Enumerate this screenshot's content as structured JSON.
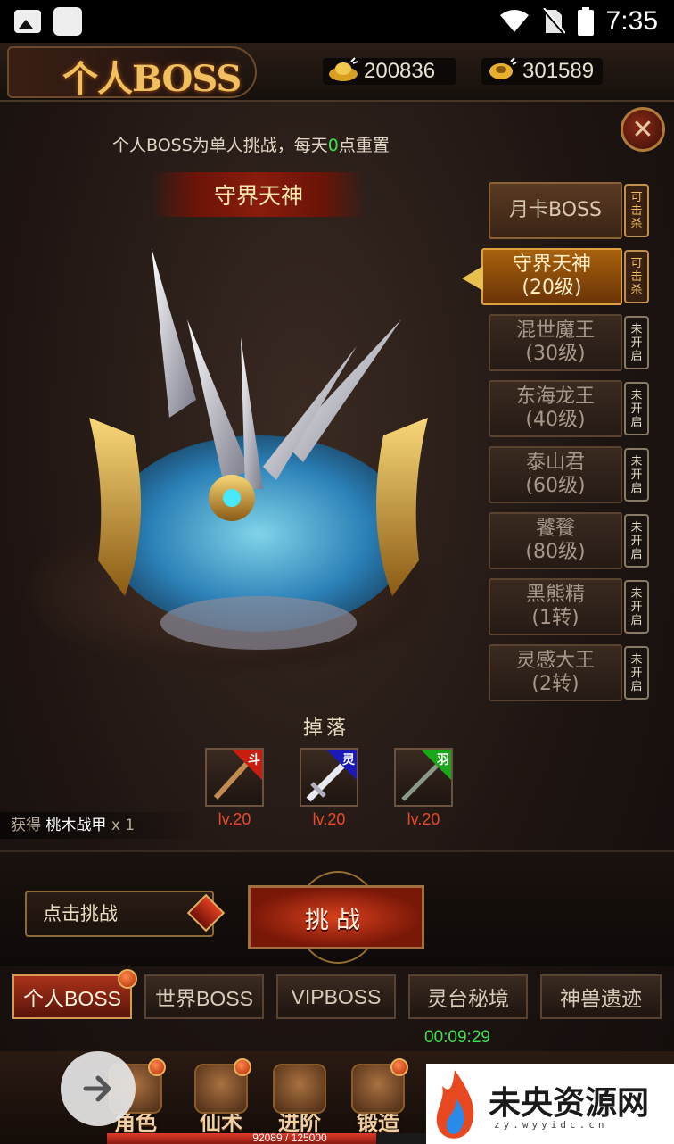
{
  "status_bar": {
    "time": "7:35"
  },
  "header": {
    "title": "个人BOSS",
    "gold": "200836",
    "ingot": "301589"
  },
  "subtitle": {
    "before": "个人BOSS为单人挑战，每天",
    "highlight": "0",
    "after": "点重置"
  },
  "boss_name": "守界天神",
  "boss_list": [
    {
      "name": "月卡BOSS",
      "level": "",
      "tag": "可击杀",
      "state": "top"
    },
    {
      "name": "守界天神",
      "level": "(20级)",
      "tag": "可击杀",
      "state": "active"
    },
    {
      "name": "混世魔王",
      "level": "(30级)",
      "tag": "未开启",
      "state": "locked"
    },
    {
      "name": "东海龙王",
      "level": "(40级)",
      "tag": "未开启",
      "state": "locked"
    },
    {
      "name": "泰山君",
      "level": "(60级)",
      "tag": "未开启",
      "state": "locked"
    },
    {
      "name": "饕餮",
      "level": "(80级)",
      "tag": "未开启",
      "state": "locked"
    },
    {
      "name": "黑熊精",
      "level": "(1转)",
      "tag": "未开启",
      "state": "locked"
    },
    {
      "name": "灵感大王",
      "level": "(2转)",
      "tag": "未开启",
      "state": "locked"
    }
  ],
  "drops": {
    "title": "掉落",
    "items": [
      {
        "badge": "斗",
        "badge_color": "#c81e10",
        "level": "lv.20"
      },
      {
        "badge": "灵",
        "badge_color": "#1a1ab8",
        "level": "lv.20"
      },
      {
        "badge": "羽",
        "badge_color": "#1aa81a",
        "level": "lv.20"
      }
    ]
  },
  "gain": {
    "label": "获得",
    "item": "桃木战甲",
    "count": "x 1"
  },
  "actions": {
    "tap_label": "点击挑战",
    "challenge_label": "挑战"
  },
  "tabs": [
    {
      "label": "个人BOSS",
      "active": true
    },
    {
      "label": "世界BOSS"
    },
    {
      "label": "VIPBOSS"
    },
    {
      "label": "灵台秘境"
    },
    {
      "label": "神兽遗迹"
    }
  ],
  "timer": "00:09:29",
  "bottom_nav": [
    {
      "label": "角色"
    },
    {
      "label": "仙术"
    },
    {
      "label": "进阶"
    },
    {
      "label": "锻造"
    }
  ],
  "exp": {
    "text": "92089 / 125000",
    "fraction": 0.7367
  },
  "watermark": {
    "text": "未央资源网",
    "sub": "zy.wyyidc.cn"
  }
}
